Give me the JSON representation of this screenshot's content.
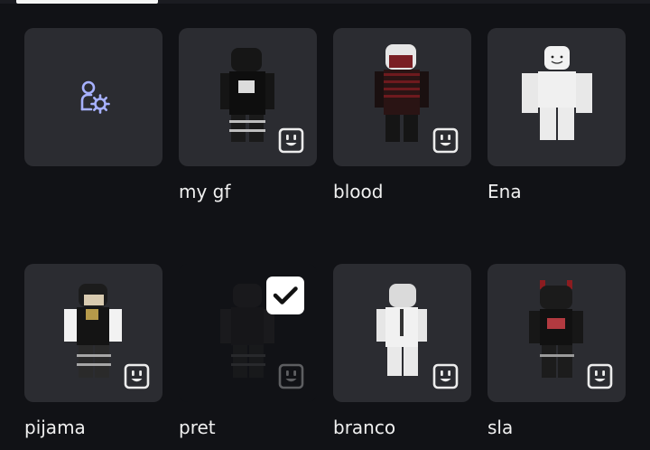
{
  "outfits": [
    {
      "id": "create",
      "label": "",
      "type": "create"
    },
    {
      "id": "my-gf",
      "label": "my gf",
      "type": "outfit"
    },
    {
      "id": "blood",
      "label": "blood",
      "type": "outfit"
    },
    {
      "id": "ena",
      "label": "Ena",
      "type": "outfit"
    },
    {
      "id": "pijama",
      "label": "pijama",
      "type": "outfit"
    },
    {
      "id": "pret",
      "label": "pret",
      "type": "outfit",
      "selected": true
    },
    {
      "id": "branco",
      "label": "branco",
      "type": "outfit"
    },
    {
      "id": "sla",
      "label": "sla",
      "type": "outfit"
    }
  ],
  "colors": {
    "background": "#111216",
    "card": "#2b2c31",
    "accent": "#ffffff"
  },
  "icons": {
    "create": "create-outfit-icon",
    "emote": "emote-face-icon",
    "check": "checkmark-icon"
  }
}
